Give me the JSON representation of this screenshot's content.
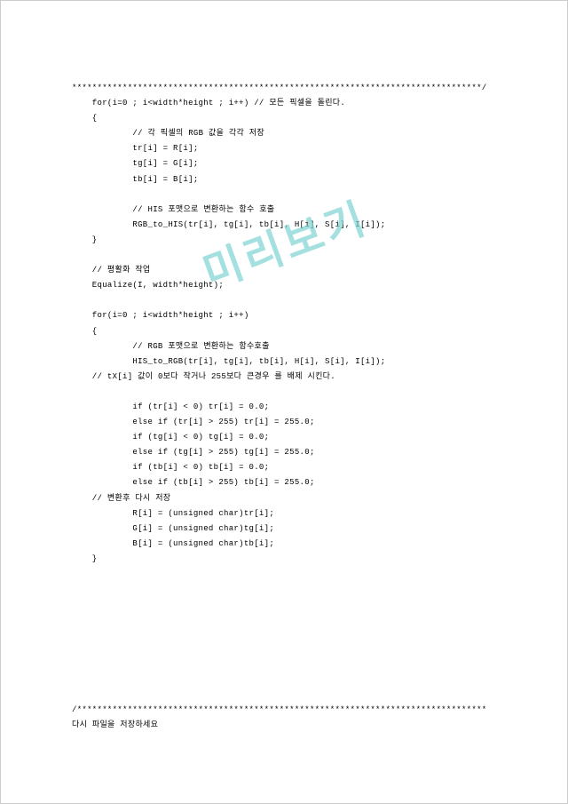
{
  "watermark": "미리보기",
  "code": {
    "sep1": "*********************************************************************************/",
    "l01": "    for(i=0 ; i<width*height ; i++) // 모든 픽셀을 돌린다.",
    "l02": "    {",
    "l03": "            // 각 픽셀의 RGB 값을 각각 저장",
    "l04": "            tr[i] = R[i];",
    "l05": "            tg[i] = G[i];",
    "l06": "            tb[i] = B[i];",
    "l07": "",
    "l08": "            // HIS 포맷으로 변환하는 함수 호출",
    "l09": "            RGB_to_HIS(tr[i], tg[i], tb[i], H[i], S[i], I[i]);",
    "l10": "    }",
    "l11": "",
    "l12": "    // 평활화 작업",
    "l13": "    Equalize(I, width*height);",
    "l14": "",
    "l15": "    for(i=0 ; i<width*height ; i++)",
    "l16": "    {",
    "l17": "            // RGB 포맷으로 변환하는 함수호출",
    "l18": "            HIS_to_RGB(tr[i], tg[i], tb[i], H[i], S[i], I[i]);",
    "l19": "    // tX[i] 값이 0보다 작거나 255보다 큰경우 를 배제 시킨다.",
    "l20": "",
    "l21": "            if (tr[i] < 0) tr[i] = 0.0;",
    "l22": "            else if (tr[i] > 255) tr[i] = 255.0;",
    "l23": "            if (tg[i] < 0) tg[i] = 0.0;",
    "l24": "            else if (tg[i] > 255) tg[i] = 255.0;",
    "l25": "            if (tb[i] < 0) tb[i] = 0.0;",
    "l26": "            else if (tb[i] > 255) tb[i] = 255.0;",
    "l27": "    // 변환후 다시 저장",
    "l28": "            R[i] = (unsigned char)tr[i];",
    "l29": "            G[i] = (unsigned char)tg[i];",
    "l30": "            B[i] = (unsigned char)tb[i];",
    "l31": "    }",
    "sep2": "/*********************************************************************************",
    "foot": "다시 파일을 저장하세요"
  }
}
